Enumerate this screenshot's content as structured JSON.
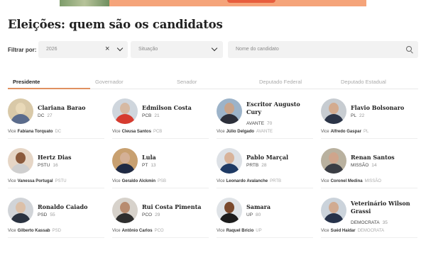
{
  "page": {
    "title": "Eleições: quem são os candidatos"
  },
  "filters": {
    "label": "Filtrar por:",
    "year_value": "2026",
    "situation_placeholder": "Situação",
    "name_placeholder": "Nome do candidato"
  },
  "tabs": [
    {
      "label": "Presidente"
    },
    {
      "label": "Governador"
    },
    {
      "label": "Senador"
    },
    {
      "label": "Deputado Federal"
    },
    {
      "label": "Deputado Estadual"
    }
  ],
  "vice_prefix": "Vice",
  "candidates": [
    {
      "name": "Clariana Barao",
      "party": "DC",
      "number": "27",
      "vice": "Fabiana Torquato",
      "vice_party": "DC"
    },
    {
      "name": "Edmilson Costa",
      "party": "PCB",
      "number": "21",
      "vice": "Cleusa Santos",
      "vice_party": "PCB"
    },
    {
      "name": "Escritor Augusto Cury",
      "party": "AVANTE",
      "number": "70",
      "vice": "Júlio Delgado",
      "vice_party": "AVANTE"
    },
    {
      "name": "Flavio Bolsonaro",
      "party": "PL",
      "number": "22",
      "vice": "Alfredo Gaspar",
      "vice_party": "PL"
    },
    {
      "name": "Hertz Dias",
      "party": "PSTU",
      "number": "16",
      "vice": "Vanessa Portugal",
      "vice_party": "PSTU"
    },
    {
      "name": "Lula",
      "party": "PT",
      "number": "13",
      "vice": "Geraldo Alckmin",
      "vice_party": "PSB"
    },
    {
      "name": "Pablo Marçal",
      "party": "PRTB",
      "number": "28",
      "vice": "Leonardo Avalanche",
      "vice_party": "PRTB"
    },
    {
      "name": "Renan Santos",
      "party": "MISSÃO",
      "number": "14",
      "vice": "Coronel Medina",
      "vice_party": "MISSÃO"
    },
    {
      "name": "Ronaldo Caiado",
      "party": "PSD",
      "number": "55",
      "vice": "Gilberto Kassab",
      "vice_party": "PSD"
    },
    {
      "name": "Rui Costa Pimenta",
      "party": "PCO",
      "number": "29",
      "vice": "Antônio Carlos",
      "vice_party": "PCO"
    },
    {
      "name": "Samara",
      "party": "UP",
      "number": "80",
      "vice": "Raquel Brício",
      "vice_party": "UP"
    },
    {
      "name": "Veterinário Wilson Grassi",
      "party": "DEMOCRATA",
      "number": "35",
      "vice": "Suéd Haidar",
      "vice_party": "DEMOCRATA"
    }
  ],
  "colors": {
    "accent": "#e09060",
    "field_bg": "#f2f2f2",
    "banner": "#f5a47a"
  }
}
